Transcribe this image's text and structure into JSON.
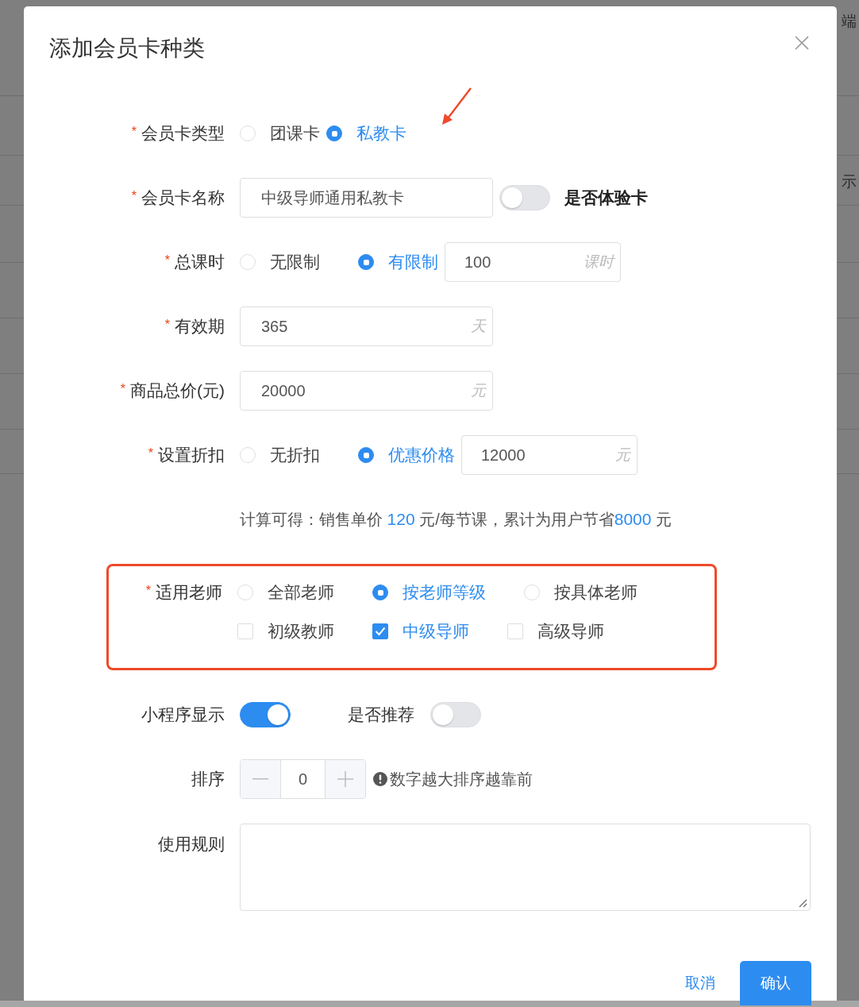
{
  "backdrop": {
    "texts": [
      "端",
      "示"
    ]
  },
  "dialog": {
    "title": "添加会员卡种类"
  },
  "form": [
    {
      "kind": "radio",
      "label": "会员卡类型",
      "marker": "*",
      "options": [
        {
          "label": "团课卡",
          "selected": false
        },
        {
          "label": "私教卡",
          "selected": true
        }
      ]
    },
    {
      "kind": "input_switch",
      "label": "会员卡名称",
      "marker": "*",
      "value": "中级导师通用私教卡",
      "switch": {
        "label": "是否体验卡",
        "on": false
      }
    },
    {
      "kind": "radio",
      "label": "总课时",
      "marker": "*",
      "options": [
        {
          "label": "无限制",
          "selected": false
        },
        {
          "label": "有限制",
          "selected": true
        }
      ],
      "input": {
        "value": "100",
        "suffix": "课时"
      }
    },
    {
      "kind": "input",
      "label": "有效期",
      "marker": "*",
      "value": "365",
      "suffix": "天"
    },
    {
      "kind": "input",
      "label": "商品总价(元)",
      "marker": "*",
      "value": "20000",
      "suffix": "元"
    },
    {
      "kind": "radio",
      "label": "设置折扣",
      "marker": "*",
      "options": [
        {
          "label": "无折扣",
          "selected": false
        },
        {
          "label": "优惠价格",
          "selected": true
        }
      ],
      "input": {
        "value": "12000",
        "suffix": "元"
      }
    },
    {
      "kind": "note",
      "parts": [
        {
          "text": "计算可得：销售单价 ",
          "highlight": false
        },
        {
          "text": "120",
          "highlight": true
        },
        {
          "text": " 元/每节课，累计为用户节省",
          "highlight": false
        },
        {
          "text": "8000",
          "highlight": true
        },
        {
          "text": " 元",
          "highlight": false
        }
      ]
    },
    {
      "kind": "teachers",
      "label": "适用老师",
      "marker": "*",
      "outlined": true,
      "options": [
        {
          "label": "全部老师",
          "selected": false
        },
        {
          "label": "按老师等级",
          "selected": true
        },
        {
          "label": "按具体老师",
          "selected": false
        }
      ],
      "levels": [
        {
          "label": "初级教师",
          "checked": false
        },
        {
          "label": "中级导师",
          "checked": true
        },
        {
          "label": "高级导师",
          "checked": false
        }
      ]
    },
    {
      "kind": "switches",
      "items": [
        {
          "label": "小程序显示",
          "on": true
        },
        {
          "label": "是否推荐",
          "on": false
        }
      ]
    },
    {
      "kind": "stepper",
      "label": "排序",
      "value": "0",
      "hint": "数字越大排序越靠前"
    },
    {
      "kind": "textarea",
      "label": "使用规则"
    }
  ],
  "footer": {
    "buttons": [
      {
        "label": "取消",
        "kind": "text"
      },
      {
        "label": "确认",
        "kind": "primary"
      }
    ]
  }
}
